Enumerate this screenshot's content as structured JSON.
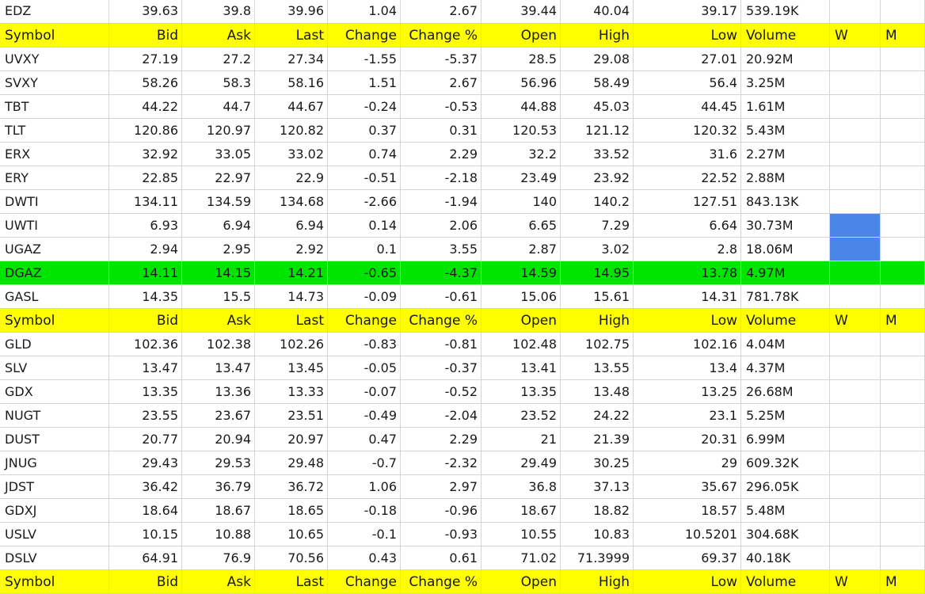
{
  "columns": [
    "Symbol",
    "Bid",
    "Ask",
    "Last",
    "Change",
    "Change %",
    "Open",
    "High",
    "Low",
    "Volume",
    "W",
    "M"
  ],
  "colors": {
    "header_fill": "#ffff00",
    "highlight_fill": "#00e500",
    "marker_fill": "#4a86e8",
    "grid": "#d4d4d4"
  },
  "rows": [
    {
      "type": "data",
      "cells": [
        "EDZ",
        "39.63",
        "39.8",
        "39.96",
        "1.04",
        "2.67",
        "39.44",
        "40.04",
        "39.17",
        "539.19K",
        "",
        ""
      ]
    },
    {
      "type": "header",
      "cells": [
        "Symbol",
        "Bid",
        "Ask",
        "Last",
        "Change",
        "Change %",
        "Open",
        "High",
        "Low",
        "Volume",
        "W",
        "M"
      ]
    },
    {
      "type": "data",
      "cells": [
        "UVXY",
        "27.19",
        "27.2",
        "27.34",
        "-1.55",
        "-5.37",
        "28.5",
        "29.08",
        "27.01",
        "20.92M",
        "",
        ""
      ]
    },
    {
      "type": "data",
      "cells": [
        "SVXY",
        "58.26",
        "58.3",
        "58.16",
        "1.51",
        "2.67",
        "56.96",
        "58.49",
        "56.4",
        "3.25M",
        "",
        ""
      ]
    },
    {
      "type": "data",
      "cells": [
        "TBT",
        "44.22",
        "44.7",
        "44.67",
        "-0.24",
        "-0.53",
        "44.88",
        "45.03",
        "44.45",
        "1.61M",
        "",
        ""
      ]
    },
    {
      "type": "data",
      "cells": [
        "TLT",
        "120.86",
        "120.97",
        "120.82",
        "0.37",
        "0.31",
        "120.53",
        "121.12",
        "120.32",
        "5.43M",
        "",
        ""
      ]
    },
    {
      "type": "data",
      "cells": [
        "ERX",
        "32.92",
        "33.05",
        "33.02",
        "0.74",
        "2.29",
        "32.2",
        "33.52",
        "31.6",
        "2.27M",
        "",
        ""
      ]
    },
    {
      "type": "data",
      "cells": [
        "ERY",
        "22.85",
        "22.97",
        "22.9",
        "-0.51",
        "-2.18",
        "23.49",
        "23.92",
        "22.52",
        "2.88M",
        "",
        ""
      ]
    },
    {
      "type": "data",
      "cells": [
        "DWTI",
        "134.11",
        "134.59",
        "134.68",
        "-2.66",
        "-1.94",
        "140",
        "140.2",
        "127.51",
        "843.13K",
        "",
        ""
      ]
    },
    {
      "type": "data",
      "marker": "W",
      "cells": [
        "UWTI",
        "6.93",
        "6.94",
        "6.94",
        "0.14",
        "2.06",
        "6.65",
        "7.29",
        "6.64",
        "30.73M",
        "",
        ""
      ]
    },
    {
      "type": "data",
      "marker": "W",
      "cells": [
        "UGAZ",
        "2.94",
        "2.95",
        "2.92",
        "0.1",
        "3.55",
        "2.87",
        "3.02",
        "2.8",
        "18.06M",
        "",
        ""
      ]
    },
    {
      "type": "highlight",
      "cells": [
        "DGAZ",
        "14.11",
        "14.15",
        "14.21",
        "-0.65",
        "-4.37",
        "14.59",
        "14.95",
        "13.78",
        "4.97M",
        "",
        ""
      ]
    },
    {
      "type": "data",
      "cells": [
        "GASL",
        "14.35",
        "15.5",
        "14.73",
        "-0.09",
        "-0.61",
        "15.06",
        "15.61",
        "14.31",
        "781.78K",
        "",
        ""
      ]
    },
    {
      "type": "header",
      "cells": [
        "Symbol",
        "Bid",
        "Ask",
        "Last",
        "Change",
        "Change %",
        "Open",
        "High",
        "Low",
        "Volume",
        "W",
        "M"
      ]
    },
    {
      "type": "data",
      "cells": [
        "GLD",
        "102.36",
        "102.38",
        "102.26",
        "-0.83",
        "-0.81",
        "102.48",
        "102.75",
        "102.16",
        "4.04M",
        "",
        ""
      ]
    },
    {
      "type": "data",
      "cells": [
        "SLV",
        "13.47",
        "13.47",
        "13.45",
        "-0.05",
        "-0.37",
        "13.41",
        "13.55",
        "13.4",
        "4.37M",
        "",
        ""
      ]
    },
    {
      "type": "data",
      "cells": [
        "GDX",
        "13.35",
        "13.36",
        "13.33",
        "-0.07",
        "-0.52",
        "13.35",
        "13.48",
        "13.25",
        "26.68M",
        "",
        ""
      ]
    },
    {
      "type": "data",
      "cells": [
        "NUGT",
        "23.55",
        "23.67",
        "23.51",
        "-0.49",
        "-2.04",
        "23.52",
        "24.22",
        "23.1",
        "5.25M",
        "",
        ""
      ]
    },
    {
      "type": "data",
      "cells": [
        "DUST",
        "20.77",
        "20.94",
        "20.97",
        "0.47",
        "2.29",
        "21",
        "21.39",
        "20.31",
        "6.99M",
        "",
        ""
      ]
    },
    {
      "type": "data",
      "cells": [
        "JNUG",
        "29.43",
        "29.53",
        "29.48",
        "-0.7",
        "-2.32",
        "29.49",
        "30.25",
        "29",
        "609.32K",
        "",
        ""
      ]
    },
    {
      "type": "data",
      "cells": [
        "JDST",
        "36.42",
        "36.79",
        "36.72",
        "1.06",
        "2.97",
        "36.8",
        "37.13",
        "35.67",
        "296.05K",
        "",
        ""
      ]
    },
    {
      "type": "data",
      "cells": [
        "GDXJ",
        "18.64",
        "18.67",
        "18.65",
        "-0.18",
        "-0.96",
        "18.67",
        "18.82",
        "18.57",
        "5.48M",
        "",
        ""
      ]
    },
    {
      "type": "data",
      "cells": [
        "USLV",
        "10.15",
        "10.88",
        "10.65",
        "-0.1",
        "-0.93",
        "10.55",
        "10.83",
        "10.5201",
        "304.68K",
        "",
        ""
      ]
    },
    {
      "type": "data",
      "cells": [
        "DSLV",
        "64.91",
        "76.9",
        "70.56",
        "0.43",
        "0.61",
        "71.02",
        "71.3999",
        "69.37",
        "40.18K",
        "",
        ""
      ]
    },
    {
      "type": "header",
      "cells": [
        "Symbol",
        "Bid",
        "Ask",
        "Last",
        "Change",
        "Change %",
        "Open",
        "High",
        "Low",
        "Volume",
        "W",
        "M"
      ]
    }
  ]
}
